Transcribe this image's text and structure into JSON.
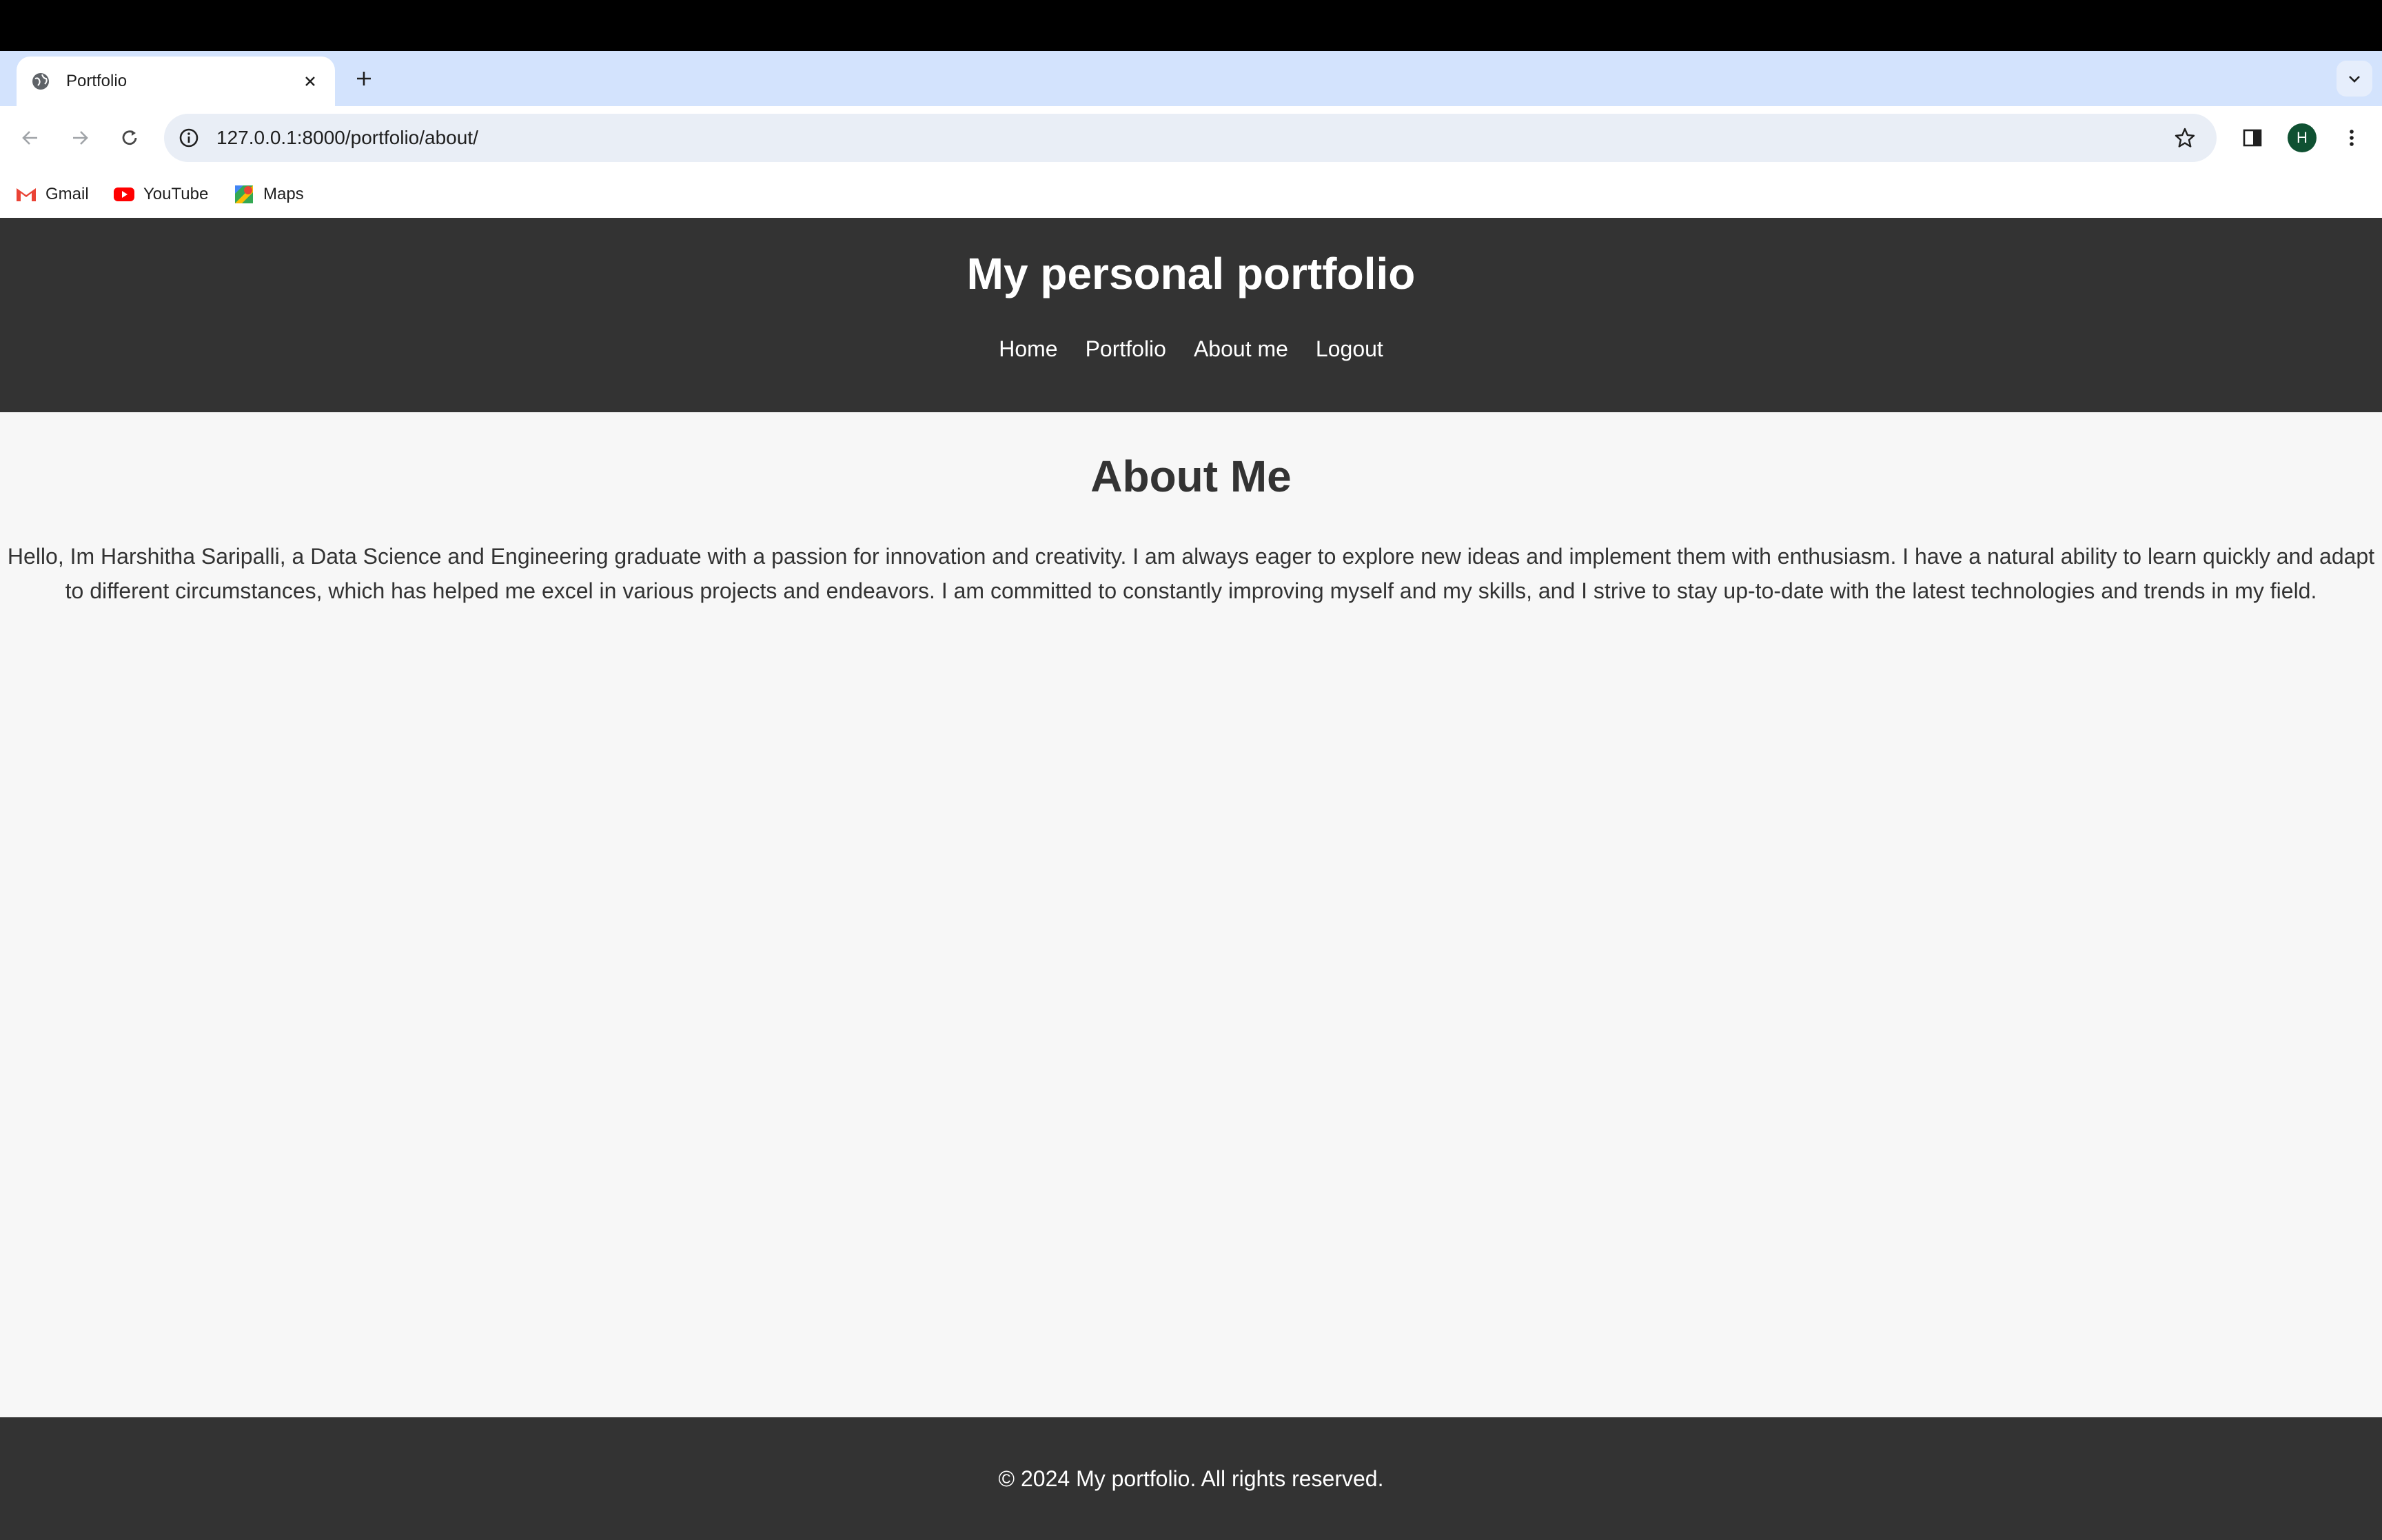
{
  "browser": {
    "tab": {
      "title": "Portfolio"
    },
    "address_bar": {
      "url": "127.0.0.1:8000/portfolio/about/"
    },
    "profile_initial": "H",
    "bookmarks": [
      {
        "label": "Gmail",
        "icon": "gmail-icon"
      },
      {
        "label": "YouTube",
        "icon": "youtube-icon"
      },
      {
        "label": "Maps",
        "icon": "maps-icon"
      }
    ]
  },
  "site": {
    "title": "My personal portfolio",
    "nav": [
      "Home",
      "Portfolio",
      "About me",
      "Logout"
    ],
    "heading": "About Me",
    "about_text": "Hello, Im Harshitha Saripalli, a Data Science and Engineering graduate with a passion for innovation and creativity. I am always eager to explore new ideas and implement them with enthusiasm. I have a natural ability to learn quickly and adapt to different circumstances, which has helped me excel in various projects and endeavors. I am committed to constantly improving myself and my skills, and I strive to stay up-to-date with the latest technologies and trends in my field.",
    "footer": "© 2024 My portfolio. All rights reserved."
  },
  "colors": {
    "header_bg": "#333333",
    "page_bg": "#f7f7f7",
    "tabstrip_bg": "#d3e3fd"
  }
}
